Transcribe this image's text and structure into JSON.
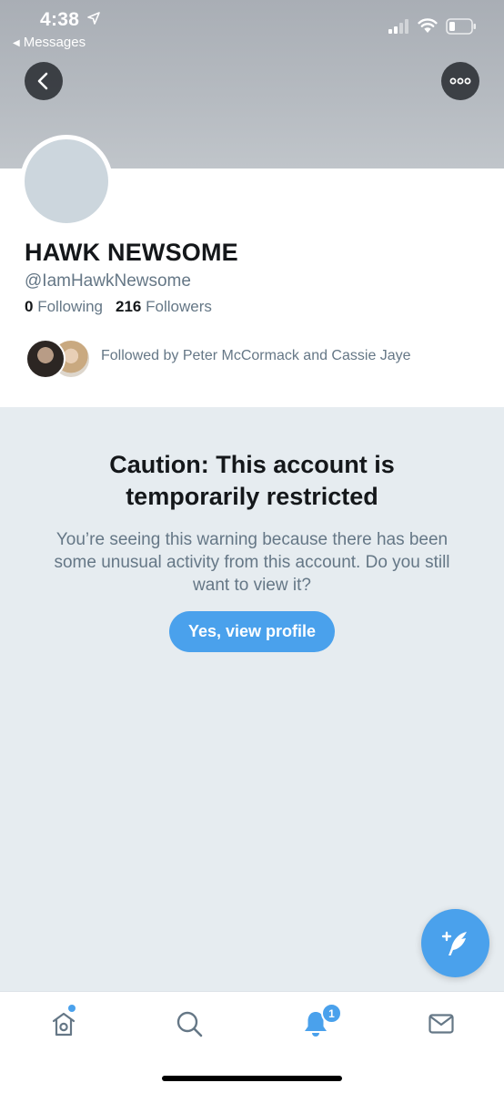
{
  "status_bar": {
    "time": "4:38",
    "back_app": "Messages"
  },
  "profile": {
    "display_name": "HAWK NEWSOME",
    "handle": "@IamHawkNewsome",
    "following_count": "0",
    "following_label": "Following",
    "followers_count": "216",
    "followers_label": "Followers",
    "followed_by": "Followed by Peter McCormack and Cassie Jaye"
  },
  "warning": {
    "title_line1": "Caution: This account is",
    "title_line2": "temporarily restricted",
    "body": "You’re seeing this warning because there has been some unusual activity from this account. Do you still want to view it?",
    "button_label": "Yes, view profile"
  },
  "tab_bar": {
    "items": [
      {
        "name": "home",
        "icon": "home-icon",
        "has_dot": true
      },
      {
        "name": "search",
        "icon": "search-icon"
      },
      {
        "name": "notifications",
        "icon": "bell-icon",
        "badge": "1"
      },
      {
        "name": "messages",
        "icon": "mail-icon"
      }
    ]
  },
  "colors": {
    "accent": "#4aa1ec",
    "text_primary": "#14171a",
    "text_secondary": "#657786",
    "background": "#e6ecf0"
  }
}
